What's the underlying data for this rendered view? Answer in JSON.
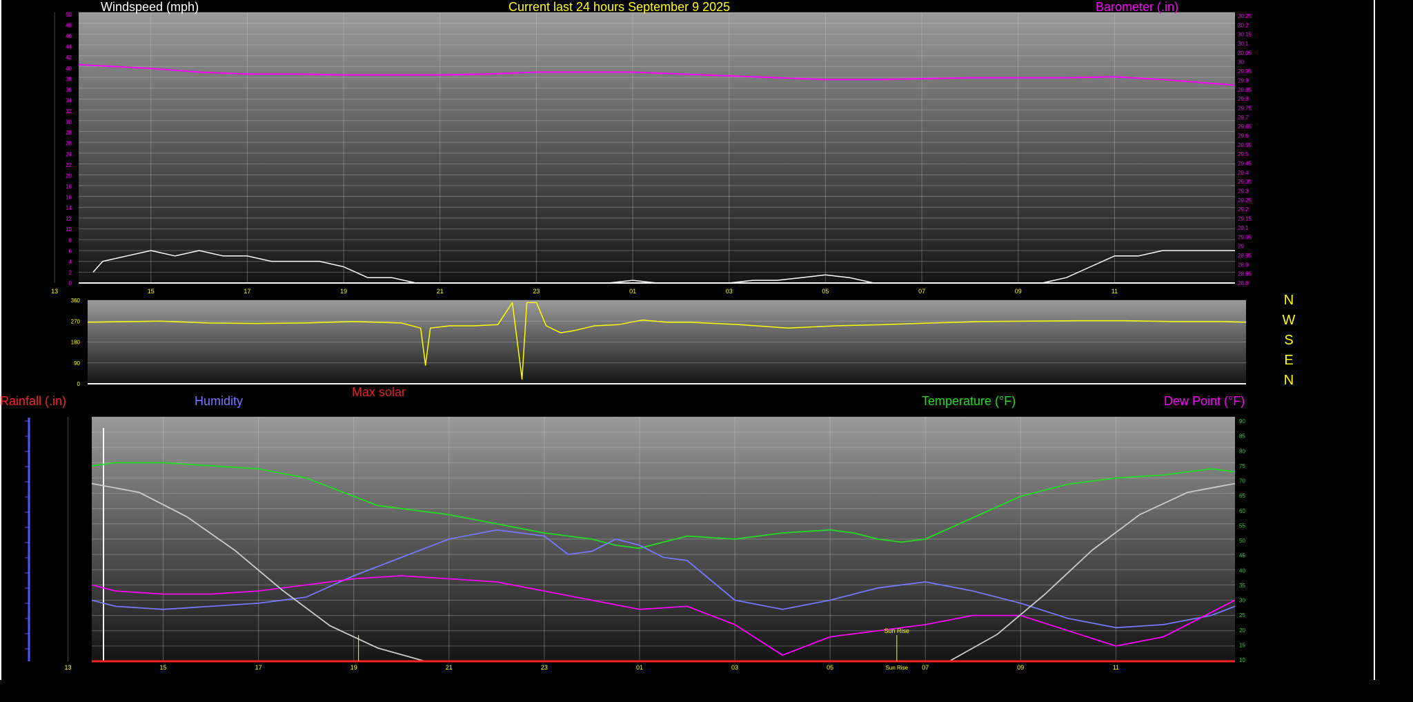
{
  "colors": {
    "wind": "#ffffff",
    "gust": "#22dd22",
    "barometer": "#ff00ff",
    "direction": "#ffff00",
    "humidity": "#7777ff",
    "temperature": "#22dd22",
    "dewpoint": "#ff00ff",
    "rainfall": "#ff2222",
    "solar": "#cccccc",
    "title": "#ffff00"
  },
  "top_legends": {
    "windspeed": "Windspeed (mph)",
    "title": "Current last 24 hours September 9 2025",
    "barometer": "Barometer (.in)"
  },
  "bottom_legends": {
    "rainfall": "Rainfall (.in)",
    "humidity": "Humidity",
    "max_solar": "Max solar",
    "temperature": "Temperature (°F)",
    "dewpoint": "Dew Point (°F)"
  },
  "compass": [
    "N",
    "W",
    "S",
    "E",
    "N"
  ],
  "annotations": {
    "sunrise_a": "Sun Rise",
    "sunrise_b": "Sun Rise"
  },
  "chart_data": [
    {
      "id": "wind",
      "type": "line",
      "title": "Current last 24 hours September 9 2025",
      "x_ticks": [
        "15",
        "17",
        "19",
        "21",
        "23",
        "01",
        "03",
        "05",
        "07",
        "09",
        "11",
        "13"
      ],
      "y_left_ticks": [
        "0",
        "2",
        "4",
        "6",
        "8",
        "10",
        "12",
        "14",
        "16",
        "18",
        "20",
        "22",
        "24",
        "26",
        "28",
        "30",
        "32",
        "34",
        "36",
        "38",
        "40",
        "42",
        "44",
        "46",
        "48",
        "50"
      ],
      "y_right_ticks": [
        "28.8",
        "28.85",
        "28.9",
        "28.95",
        "29",
        "29.05",
        "29.1",
        "29.15",
        "29.2",
        "29.25",
        "29.3",
        "29.35",
        "29.4",
        "29.45",
        "29.5",
        "29.55",
        "29.6",
        "29.65",
        "29.7",
        "29.75",
        "29.8",
        "29.85",
        "29.9",
        "29.95",
        "30",
        "30.05",
        "30.1",
        "30.15",
        "30.2",
        "30.25"
      ],
      "ylim_left": [
        0,
        50
      ],
      "ylim_right": [
        28.8,
        30.25
      ],
      "grid": true,
      "series": [
        {
          "name": "Windspeed (mph)",
          "axis": "left",
          "x": [
            13.8,
            14,
            14.5,
            15,
            15.5,
            16,
            16.5,
            17,
            17.5,
            18,
            18.5,
            19,
            19.5,
            20,
            20.5,
            21,
            21.5,
            22,
            22.5,
            23,
            23.5,
            24,
            24.5,
            25,
            25.5,
            26,
            26.5,
            27,
            27.5,
            28,
            28.5,
            29,
            29.5,
            30,
            30.5,
            31,
            31.5,
            32,
            32.5,
            33,
            33.5,
            34,
            34.5,
            35,
            35.5,
            36,
            36.5,
            37,
            37.5
          ],
          "y": [
            2,
            4,
            5,
            6,
            5,
            6,
            5,
            5,
            4,
            4,
            4,
            3,
            1,
            1,
            0,
            0,
            0,
            0,
            0,
            0,
            0,
            0,
            0,
            0.5,
            0,
            0,
            0,
            0,
            0.5,
            0.5,
            1,
            1.5,
            1,
            0,
            0,
            0,
            0,
            0,
            0,
            0,
            0,
            1,
            3,
            5,
            5,
            6,
            6,
            6,
            6
          ]
        },
        {
          "name": "Barometer (.in)",
          "axis": "right",
          "x": [
            13.5,
            15,
            16,
            17,
            18,
            19,
            20,
            21,
            22,
            23,
            24,
            25,
            26,
            27,
            28,
            29,
            30,
            31,
            32,
            33,
            34,
            35,
            36,
            37,
            37.5
          ],
          "y": [
            29.97,
            29.95,
            29.93,
            29.92,
            29.92,
            29.915,
            29.915,
            29.915,
            29.92,
            29.93,
            29.93,
            29.93,
            29.92,
            29.91,
            29.9,
            29.89,
            29.89,
            29.895,
            29.9,
            29.9,
            29.9,
            29.905,
            29.89,
            29.87,
            29.86
          ]
        }
      ]
    },
    {
      "id": "direction",
      "type": "line",
      "y_ticks": [
        "0",
        "90",
        "180",
        "270",
        "360"
      ],
      "ylim": [
        0,
        360
      ],
      "grid": true,
      "series": [
        {
          "name": "Wind direction",
          "x": [
            13.5,
            15,
            16,
            17,
            18,
            19,
            20,
            20.4,
            20.5,
            20.6,
            21,
            21.5,
            22,
            22.3,
            22.5,
            22.6,
            22.8,
            23,
            23.3,
            23.6,
            24,
            24.5,
            25,
            25.5,
            26,
            27,
            28,
            29,
            30,
            31,
            32,
            33,
            34,
            35,
            36,
            37,
            37.5
          ],
          "y": [
            265,
            270,
            262,
            260,
            262,
            268,
            262,
            240,
            80,
            240,
            250,
            250,
            255,
            350,
            20,
            350,
            350,
            250,
            220,
            230,
            250,
            255,
            275,
            265,
            265,
            255,
            240,
            250,
            255,
            262,
            268,
            270,
            272,
            272,
            268,
            268,
            265
          ]
        }
      ]
    },
    {
      "id": "temperature",
      "type": "line",
      "x_ticks": [
        "15",
        "17",
        "19",
        "21",
        "23",
        "01",
        "03",
        "05",
        "07",
        "09",
        "11",
        "13"
      ],
      "y_right_ticks": [
        "10",
        "15",
        "20",
        "25",
        "30",
        "35",
        "40",
        "45",
        "50",
        "55",
        "60",
        "65",
        "70",
        "75",
        "80",
        "85",
        "90"
      ],
      "ylim_right": [
        10,
        90
      ],
      "ylim_left": [
        0,
        1.1
      ],
      "grid": true,
      "series": [
        {
          "name": "Temperature (°F)",
          "axis": "right",
          "x": [
            13.5,
            14,
            15,
            16,
            17,
            18,
            19,
            19.5,
            20,
            21,
            22,
            23,
            24,
            24.5,
            25,
            25.5,
            26,
            27,
            28,
            29,
            29.5,
            30,
            30.5,
            31,
            32,
            33,
            34,
            35,
            36,
            37,
            37.5
          ],
          "y": [
            74,
            75,
            75,
            74,
            73,
            70,
            64,
            61,
            60,
            58,
            55,
            52,
            50,
            48,
            47,
            49,
            51,
            50,
            52,
            53,
            52,
            50,
            49,
            50,
            57,
            64,
            68,
            70,
            71,
            73,
            72
          ]
        },
        {
          "name": "Humidity",
          "axis": "right",
          "x": [
            13.5,
            14,
            15,
            16,
            17,
            18,
            19,
            20,
            21,
            22,
            23,
            23.5,
            24,
            24.5,
            25,
            25.5,
            26,
            27,
            28,
            29,
            30,
            31,
            32,
            33,
            34,
            35,
            36,
            37,
            37.5
          ],
          "y": [
            30,
            28,
            27,
            28,
            29,
            31,
            38,
            44,
            50,
            53,
            51,
            45,
            46,
            50,
            48,
            44,
            43,
            30,
            27,
            30,
            34,
            36,
            33,
            29,
            24,
            21,
            22,
            25,
            28
          ]
        },
        {
          "name": "Dew Point (°F)",
          "axis": "right",
          "x": [
            13.5,
            14,
            15,
            16,
            17,
            18,
            19,
            20,
            21,
            22,
            23,
            24,
            25,
            26,
            27,
            28,
            29,
            30,
            31,
            32,
            33,
            34,
            35,
            36,
            37,
            37.5
          ],
          "y": [
            35,
            33,
            32,
            32,
            33,
            35,
            37,
            38,
            37,
            36,
            33,
            30,
            27,
            28,
            22,
            12,
            18,
            20,
            22,
            25,
            25,
            20,
            15,
            18,
            26,
            30
          ]
        },
        {
          "name": "Max solar",
          "axis": "left",
          "x": [
            13.5,
            14.5,
            15.5,
            16.5,
            17.5,
            18.5,
            19.5,
            20.5,
            21.5,
            22.5,
            23.5,
            24.5,
            25.5,
            26.5,
            27.5,
            28.5,
            29.5,
            30.5,
            31.5,
            32.5,
            33.5,
            34.5,
            35.5,
            36.5,
            37.5
          ],
          "y": [
            0.8,
            0.76,
            0.65,
            0.5,
            0.32,
            0.16,
            0.06,
            0,
            0,
            0,
            0,
            0,
            0,
            0,
            0,
            0,
            0,
            0,
            0,
            0.12,
            0.3,
            0.5,
            0.66,
            0.76,
            0.8
          ]
        },
        {
          "name": "Rainfall (.in)",
          "axis": "left",
          "x": [
            13.5,
            37.5
          ],
          "y": [
            0,
            0
          ]
        }
      ]
    }
  ]
}
